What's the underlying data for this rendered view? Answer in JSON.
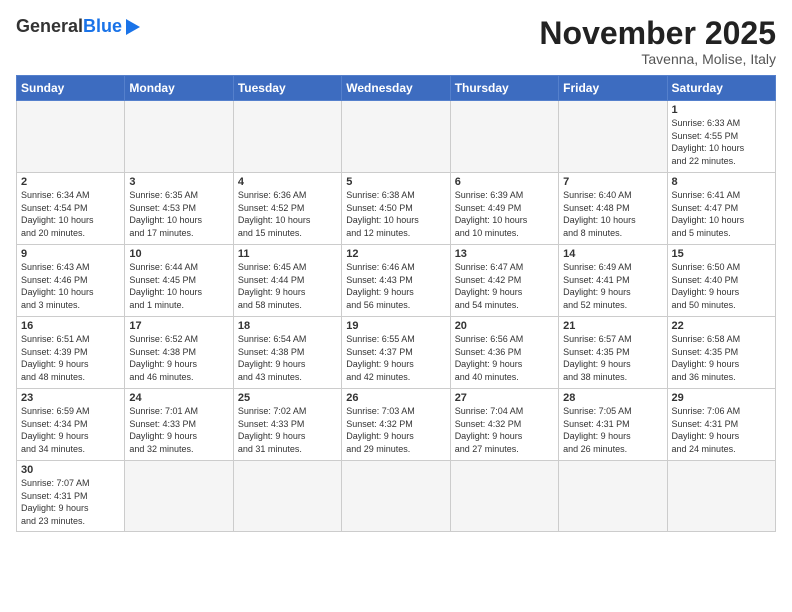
{
  "header": {
    "logo_general": "General",
    "logo_blue": "Blue",
    "month_title": "November 2025",
    "subtitle": "Tavenna, Molise, Italy"
  },
  "weekdays": [
    "Sunday",
    "Monday",
    "Tuesday",
    "Wednesday",
    "Thursday",
    "Friday",
    "Saturday"
  ],
  "weeks": [
    [
      {
        "day": "",
        "info": ""
      },
      {
        "day": "",
        "info": ""
      },
      {
        "day": "",
        "info": ""
      },
      {
        "day": "",
        "info": ""
      },
      {
        "day": "",
        "info": ""
      },
      {
        "day": "",
        "info": ""
      },
      {
        "day": "1",
        "info": "Sunrise: 6:33 AM\nSunset: 4:55 PM\nDaylight: 10 hours\nand 22 minutes."
      }
    ],
    [
      {
        "day": "2",
        "info": "Sunrise: 6:34 AM\nSunset: 4:54 PM\nDaylight: 10 hours\nand 20 minutes."
      },
      {
        "day": "3",
        "info": "Sunrise: 6:35 AM\nSunset: 4:53 PM\nDaylight: 10 hours\nand 17 minutes."
      },
      {
        "day": "4",
        "info": "Sunrise: 6:36 AM\nSunset: 4:52 PM\nDaylight: 10 hours\nand 15 minutes."
      },
      {
        "day": "5",
        "info": "Sunrise: 6:38 AM\nSunset: 4:50 PM\nDaylight: 10 hours\nand 12 minutes."
      },
      {
        "day": "6",
        "info": "Sunrise: 6:39 AM\nSunset: 4:49 PM\nDaylight: 10 hours\nand 10 minutes."
      },
      {
        "day": "7",
        "info": "Sunrise: 6:40 AM\nSunset: 4:48 PM\nDaylight: 10 hours\nand 8 minutes."
      },
      {
        "day": "8",
        "info": "Sunrise: 6:41 AM\nSunset: 4:47 PM\nDaylight: 10 hours\nand 5 minutes."
      }
    ],
    [
      {
        "day": "9",
        "info": "Sunrise: 6:43 AM\nSunset: 4:46 PM\nDaylight: 10 hours\nand 3 minutes."
      },
      {
        "day": "10",
        "info": "Sunrise: 6:44 AM\nSunset: 4:45 PM\nDaylight: 10 hours\nand 1 minute."
      },
      {
        "day": "11",
        "info": "Sunrise: 6:45 AM\nSunset: 4:44 PM\nDaylight: 9 hours\nand 58 minutes."
      },
      {
        "day": "12",
        "info": "Sunrise: 6:46 AM\nSunset: 4:43 PM\nDaylight: 9 hours\nand 56 minutes."
      },
      {
        "day": "13",
        "info": "Sunrise: 6:47 AM\nSunset: 4:42 PM\nDaylight: 9 hours\nand 54 minutes."
      },
      {
        "day": "14",
        "info": "Sunrise: 6:49 AM\nSunset: 4:41 PM\nDaylight: 9 hours\nand 52 minutes."
      },
      {
        "day": "15",
        "info": "Sunrise: 6:50 AM\nSunset: 4:40 PM\nDaylight: 9 hours\nand 50 minutes."
      }
    ],
    [
      {
        "day": "16",
        "info": "Sunrise: 6:51 AM\nSunset: 4:39 PM\nDaylight: 9 hours\nand 48 minutes."
      },
      {
        "day": "17",
        "info": "Sunrise: 6:52 AM\nSunset: 4:38 PM\nDaylight: 9 hours\nand 46 minutes."
      },
      {
        "day": "18",
        "info": "Sunrise: 6:54 AM\nSunset: 4:38 PM\nDaylight: 9 hours\nand 43 minutes."
      },
      {
        "day": "19",
        "info": "Sunrise: 6:55 AM\nSunset: 4:37 PM\nDaylight: 9 hours\nand 42 minutes."
      },
      {
        "day": "20",
        "info": "Sunrise: 6:56 AM\nSunset: 4:36 PM\nDaylight: 9 hours\nand 40 minutes."
      },
      {
        "day": "21",
        "info": "Sunrise: 6:57 AM\nSunset: 4:35 PM\nDaylight: 9 hours\nand 38 minutes."
      },
      {
        "day": "22",
        "info": "Sunrise: 6:58 AM\nSunset: 4:35 PM\nDaylight: 9 hours\nand 36 minutes."
      }
    ],
    [
      {
        "day": "23",
        "info": "Sunrise: 6:59 AM\nSunset: 4:34 PM\nDaylight: 9 hours\nand 34 minutes."
      },
      {
        "day": "24",
        "info": "Sunrise: 7:01 AM\nSunset: 4:33 PM\nDaylight: 9 hours\nand 32 minutes."
      },
      {
        "day": "25",
        "info": "Sunrise: 7:02 AM\nSunset: 4:33 PM\nDaylight: 9 hours\nand 31 minutes."
      },
      {
        "day": "26",
        "info": "Sunrise: 7:03 AM\nSunset: 4:32 PM\nDaylight: 9 hours\nand 29 minutes."
      },
      {
        "day": "27",
        "info": "Sunrise: 7:04 AM\nSunset: 4:32 PM\nDaylight: 9 hours\nand 27 minutes."
      },
      {
        "day": "28",
        "info": "Sunrise: 7:05 AM\nSunset: 4:31 PM\nDaylight: 9 hours\nand 26 minutes."
      },
      {
        "day": "29",
        "info": "Sunrise: 7:06 AM\nSunset: 4:31 PM\nDaylight: 9 hours\nand 24 minutes."
      }
    ],
    [
      {
        "day": "30",
        "info": "Sunrise: 7:07 AM\nSunset: 4:31 PM\nDaylight: 9 hours\nand 23 minutes."
      },
      {
        "day": "",
        "info": ""
      },
      {
        "day": "",
        "info": ""
      },
      {
        "day": "",
        "info": ""
      },
      {
        "day": "",
        "info": ""
      },
      {
        "day": "",
        "info": ""
      },
      {
        "day": "",
        "info": ""
      }
    ]
  ]
}
